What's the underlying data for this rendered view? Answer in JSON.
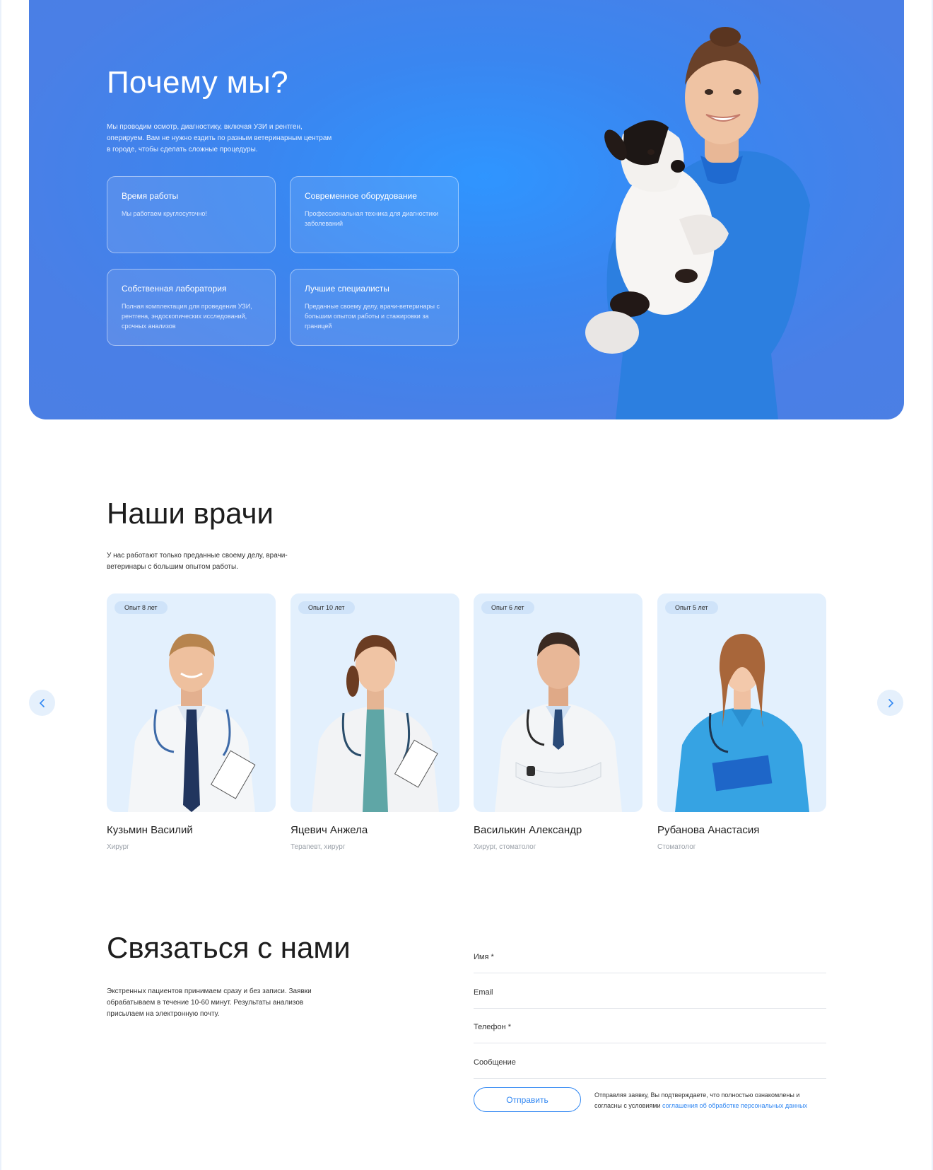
{
  "hero": {
    "title": "Почему мы?",
    "lead": "Мы проводим осмотр, диагностику, включая УЗИ и рентген, оперируем. Вам не нужно ездить по разным ветеринарным центрам в городе, чтобы сделать сложные процедуры.",
    "features": [
      {
        "title": "Время работы",
        "text": "Мы работаем круглосуточно!"
      },
      {
        "title": "Современное оборудование",
        "text": "Профессиональная техника для диагностики заболеваний"
      },
      {
        "title": "Собственная лаборатория",
        "text": "Полная комплектация для проведения УЗИ, рентгена, эндоскопических исследований, срочных анализов"
      },
      {
        "title": "Лучшие специалисты",
        "text": "Преданные своему делу, врачи-ветеринары с большим опытом работы и стажировки за границей"
      }
    ]
  },
  "doctors": {
    "title": "Наши врачи",
    "lead": "У нас работают только преданные своему делу, врачи-ветеринары с большим опытом работы.",
    "items": [
      {
        "badge": "Опыт 8 лет",
        "name": "Кузьмин Василий",
        "role": "Хирург"
      },
      {
        "badge": "Опыт 10 лет",
        "name": "Яцевич Анжела",
        "role": "Терапевт, хирург"
      },
      {
        "badge": "Опыт 6 лет",
        "name": "Василькин Александр",
        "role": "Хирург, стоматолог"
      },
      {
        "badge": "Опыт 5 лет",
        "name": "Рубанова Анастасия",
        "role": "Стоматолог"
      }
    ]
  },
  "contact": {
    "title": "Связаться с нами",
    "lead": "Экстренных пациентов принимаем сразу и без записи. Заявки обрабатываем в течение 10-60 минут. Результаты анализов присылаем на электронную почту.",
    "fields": {
      "name_placeholder": "Имя *",
      "email_placeholder": "Email",
      "phone_placeholder": "Телефон *",
      "message_placeholder": "Сообщение"
    },
    "submit_label": "Отправить",
    "consent_text": "Отправляя заявку, Вы подтверждаете, что полностью ознакомлены и согласны с условиями ",
    "consent_link": "соглашения об обработке персональных данных"
  },
  "icons": {
    "prev": "chevron-left-icon",
    "next": "chevron-right-icon"
  },
  "colors": {
    "accent": "#2f86f2",
    "hero_bg": "#3a86f0",
    "card_bg": "#e3f0fd",
    "badge_bg": "#cfe3f9"
  }
}
